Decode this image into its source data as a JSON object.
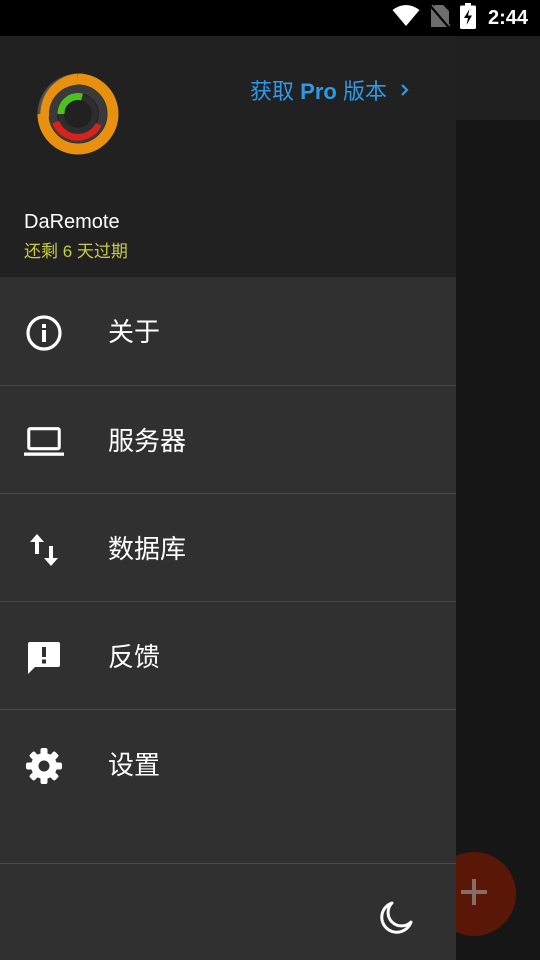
{
  "status_bar": {
    "time": "2:44",
    "icons": [
      "wifi-icon",
      "no-sim-icon",
      "battery-charging-icon"
    ]
  },
  "drawer": {
    "logo": "daremote-ring-logo",
    "pro_link": {
      "prefix": "获取",
      "bold": "Pro",
      "suffix": "版本",
      "icon": "chevron-right-icon"
    },
    "app_name": "DaRemote",
    "expiry": "还剩 6 天过期",
    "menu": [
      {
        "label": "关于",
        "icon": "info-icon"
      },
      {
        "label": "服务器",
        "icon": "laptop-icon"
      },
      {
        "label": "数据库",
        "icon": "swap-vertical-icon"
      },
      {
        "label": "反馈",
        "icon": "feedback-icon"
      },
      {
        "label": "设置",
        "icon": "gear-icon"
      }
    ],
    "footer_icon": "dark-mode-moon-icon"
  },
  "fab": {
    "icon": "plus-icon"
  },
  "colors": {
    "accent_link": "#2e9ae6",
    "expiry_text": "#c9cc3f",
    "drawer_bg": "#303030",
    "header_bg": "#212121",
    "fab_bg": "#5a1708"
  }
}
